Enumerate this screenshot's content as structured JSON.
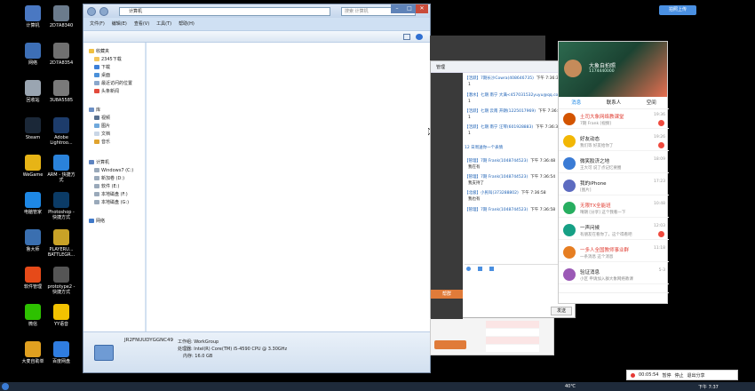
{
  "desktop_icons": [
    {
      "label": "计算机",
      "color": "#4a78c2"
    },
    {
      "label": "2D7A8340",
      "color": "#6b7b8c"
    },
    {
      "label": "网络",
      "color": "#3d6fb6"
    },
    {
      "label": "2D7A8354",
      "color": "#707070"
    },
    {
      "label": "回收站",
      "color": "#9aa5b1"
    },
    {
      "label": "3U8A5585",
      "color": "#7a7a7a"
    },
    {
      "label": "Steam",
      "color": "#1b2838"
    },
    {
      "label": "Adobe Lightroo...",
      "color": "#1d3c6b"
    },
    {
      "label": "WeGame",
      "color": "#e7b416"
    },
    {
      "label": "ARM - 快捷方式",
      "color": "#2a82da"
    },
    {
      "label": "电脑管家",
      "color": "#1e88e5"
    },
    {
      "label": "Photoshop - 快捷方式",
      "color": "#0b3b66"
    },
    {
      "label": "鲁大师",
      "color": "#3a6fb0"
    },
    {
      "label": "PLAYERU... BATTLEGR...",
      "color": "#c9a227"
    },
    {
      "label": "软件管理",
      "color": "#e64a19"
    },
    {
      "label": "prototype2 - 快捷方式",
      "color": "#555555"
    },
    {
      "label": "微信",
      "color": "#2dc100"
    },
    {
      "label": "YY语音",
      "color": "#f2c200"
    },
    {
      "label": "大麦自助单",
      "color": "#e0a020"
    },
    {
      "label": "百度网盘",
      "color": "#2f7de1"
    }
  ],
  "explorer": {
    "address_label": "计算机",
    "search_placeholder": "搜索 计算机",
    "menu": [
      "文件(F)",
      "编辑(E)",
      "查看(V)",
      "工具(T)",
      "帮助(H)"
    ],
    "nav": {
      "favorites": "收藏夹",
      "fav_items": [
        "2345下载",
        "下载",
        "桌面",
        "最近访问的位置",
        "头条新闻"
      ],
      "libraries": "库",
      "lib_items": [
        "视频",
        "图片",
        "文档",
        "音乐"
      ],
      "computer": "计算机",
      "drives": [
        "Windows7 (C:)",
        "新加卷 (D:)",
        "软件 (E:)",
        "本地磁盘 (F:)",
        "本地磁盘 (G:)"
      ],
      "network": "网络"
    },
    "details": {
      "name": "JR2FNUUDYGGNC49",
      "workgroup": "工作组: WorkGroup",
      "processor": "处理器: Intel(R) Core(TM) i5-4590 CPU @ 3.30GHz",
      "memory": "内存: 16.0 GB"
    }
  },
  "chat": {
    "header_label": "管理",
    "messages": [
      {
        "name": "【活跃】7期长沙Cowra",
        "id": "(408646735)",
        "time": "下午 7:36:31",
        "body": "1"
      },
      {
        "name": "【潜水】七期 南宁 大满",
        "id": "<457031532yuyu@qq.com>",
        "time": "下午 7:36:32",
        "body": "1"
      },
      {
        "name": "【活跃】七期 云南 开朗",
        "id": "(1225017969)",
        "time": "下午 7:36:33",
        "body": "1"
      },
      {
        "name": "【活跃】七期 南宁 汪琴",
        "id": "(601928883)",
        "time": "下午 7:36:35",
        "body": "1"
      },
      {
        "name": "12 日周",
        "id": "送你一个表情",
        "time": "",
        "body": ""
      },
      {
        "name": "【管理】7期 Frank",
        "id": "(1048744523)",
        "time": "下午 7:36:48",
        "body": "我在有"
      },
      {
        "name": "【管理】7期 Frank",
        "id": "(1048744523)",
        "time": "下午 7:36:54",
        "body": "我支持了"
      },
      {
        "name": "【北极】小民叫",
        "id": "(373288802)",
        "time": "下午 7:36:58",
        "body": "我也有"
      },
      {
        "name": "【管理】7期 Frank",
        "id": "(1048744523)",
        "time": "下午 7:36:58",
        "body": ""
      }
    ],
    "send_label": "发送",
    "left_label": "帮群"
  },
  "qq_panel": {
    "profile_name": "大象自拍照",
    "profile_sub": "1174440000",
    "tabs": [
      "消息",
      "联系人",
      "空间"
    ],
    "conversations": [
      {
        "name": "土司大象网络教课堂",
        "sub": "7期 Frank [视频]",
        "time": "19:36",
        "badge": "99",
        "name_color": "#e03c31",
        "avatar": "#d35400"
      },
      {
        "name": "好友动态",
        "sub": "我们等 好友给你了",
        "time": "19:26",
        "badge": "1",
        "name_color": "#222222",
        "avatar": "#f2b705"
      },
      {
        "name": "微笑胶济之地",
        "sub": "王大可 说了点记忆要圈",
        "time": "18:09",
        "badge": "",
        "name_color": "#222222",
        "avatar": "#3a7bd5"
      },
      {
        "name": "我的iPhone",
        "sub": "[图片]",
        "time": "17:23",
        "badge": "",
        "name_color": "#222222",
        "avatar": "#5c6bc0"
      },
      {
        "name": "无限TX全能班",
        "sub": "晴朗 [分享] 这个我看一下",
        "time": "10:48",
        "badge": "",
        "name_color": "#e03c31",
        "avatar": "#27ae60"
      },
      {
        "name": "一声问候",
        "sub": "有朋友在看你了，这个得看吧",
        "time": "12:03",
        "badge": "1",
        "name_color": "#222222",
        "avatar": "#16a085"
      },
      {
        "name": "一多人全国教师事业群",
        "sub": "一条消息 这个消息",
        "time": "11:18",
        "badge": "",
        "name_color": "#e03c31",
        "avatar": "#e67e22"
      },
      {
        "name": "验证消息",
        "sub": "小区 申请加入群大象网络教课",
        "time": "5-3",
        "badge": "",
        "name_color": "#222222",
        "avatar": "#9b59b6"
      }
    ]
  },
  "top_right_button": "拍照上传",
  "recorder": {
    "time": "00:05:54",
    "pause": "暂停",
    "stop": "停止",
    "exit": "退出分享"
  },
  "taskbar": {
    "temp": "40℃",
    "clock": "下午 7:37"
  }
}
